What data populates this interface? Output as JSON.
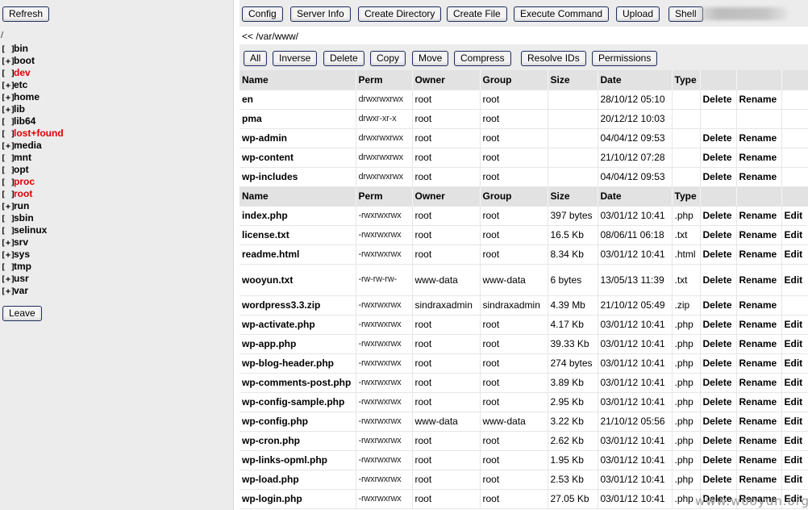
{
  "tree": {
    "refresh_label": "Refresh",
    "root": "/",
    "leave_label": "Leave",
    "items": [
      {
        "mark": "[ ]",
        "name": "bin",
        "red": false
      },
      {
        "mark": "[+]",
        "name": "boot",
        "red": false
      },
      {
        "mark": "[ ]",
        "name": "dev",
        "red": true
      },
      {
        "mark": "[+]",
        "name": "etc",
        "red": false
      },
      {
        "mark": "[+]",
        "name": "home",
        "red": false
      },
      {
        "mark": "[+]",
        "name": "lib",
        "red": false
      },
      {
        "mark": "[ ]",
        "name": "lib64",
        "red": false
      },
      {
        "mark": "[ ]",
        "name": "lost+found",
        "red": true
      },
      {
        "mark": "[+]",
        "name": "media",
        "red": false
      },
      {
        "mark": "[ ]",
        "name": "mnt",
        "red": false
      },
      {
        "mark": "[ ]",
        "name": "opt",
        "red": false
      },
      {
        "mark": "[ ]",
        "name": "proc",
        "red": true
      },
      {
        "mark": "[ ]",
        "name": "root",
        "red": true
      },
      {
        "mark": "[+]",
        "name": "run",
        "red": false
      },
      {
        "mark": "[ ]",
        "name": "sbin",
        "red": false
      },
      {
        "mark": "[ ]",
        "name": "selinux",
        "red": false
      },
      {
        "mark": "[+]",
        "name": "srv",
        "red": false
      },
      {
        "mark": "[+]",
        "name": "sys",
        "red": false
      },
      {
        "mark": "[ ]",
        "name": "tmp",
        "red": false
      },
      {
        "mark": "[+]",
        "name": "usr",
        "red": false
      },
      {
        "mark": "[+]",
        "name": "var",
        "red": false
      }
    ]
  },
  "toolbar": {
    "buttons": [
      "Config",
      "Server Info",
      "Create Directory",
      "Create File",
      "Execute Command",
      "Upload",
      "Shell"
    ]
  },
  "path": "<< /var/www/",
  "actions": {
    "buttons": [
      "All",
      "Inverse",
      "Delete",
      "Copy",
      "Move",
      "Compress",
      "Resolve IDs",
      "Permissions"
    ]
  },
  "columns": [
    "Name",
    "Perm",
    "Owner",
    "Group",
    "Size",
    "Date",
    "Type"
  ],
  "directories": [
    {
      "name": "en",
      "perm": "drwxrwxrwx",
      "owner": "root",
      "group": "root",
      "size": "",
      "date": "28/10/12 05:10",
      "type": "",
      "actions": [
        "Delete",
        "Rename"
      ]
    },
    {
      "name": "pma",
      "perm": "drwxr-xr-x",
      "owner": "root",
      "group": "root",
      "size": "",
      "date": "20/12/12 10:03",
      "type": "",
      "actions": []
    },
    {
      "name": "wp-admin",
      "perm": "drwxrwxrwx",
      "owner": "root",
      "group": "root",
      "size": "",
      "date": "04/04/12 09:53",
      "type": "",
      "actions": [
        "Delete",
        "Rename"
      ]
    },
    {
      "name": "wp-content",
      "perm": "drwxrwxrwx",
      "owner": "root",
      "group": "root",
      "size": "",
      "date": "21/10/12 07:28",
      "type": "",
      "actions": [
        "Delete",
        "Rename"
      ]
    },
    {
      "name": "wp-includes",
      "perm": "drwxrwxrwx",
      "owner": "root",
      "group": "root",
      "size": "",
      "date": "04/04/12 09:53",
      "type": "",
      "actions": [
        "Delete",
        "Rename"
      ]
    }
  ],
  "files": [
    {
      "name": "index.php",
      "perm": "-rwxrwxrwx",
      "owner": "root",
      "group": "root",
      "size": "397 bytes",
      "date": "03/01/12 10:41",
      "type": ".php",
      "actions": [
        "Delete",
        "Rename",
        "Edit"
      ]
    },
    {
      "name": "license.txt",
      "perm": "-rwxrwxrwx",
      "owner": "root",
      "group": "root",
      "size": "16.5 Kb",
      "date": "08/06/11 06:18",
      "type": ".txt",
      "actions": [
        "Delete",
        "Rename",
        "Edit"
      ]
    },
    {
      "name": "readme.html",
      "perm": "-rwxrwxrwx",
      "owner": "root",
      "group": "root",
      "size": "8.34 Kb",
      "date": "03/01/12 10:41",
      "type": ".html",
      "actions": [
        "Delete",
        "Rename",
        "Edit"
      ]
    },
    {
      "name": "wooyun.txt",
      "perm": "-rw-rw-rw-",
      "owner": "www-data",
      "group": "www-data",
      "size": "6 bytes",
      "date": "13/05/13 11:39",
      "type": ".txt",
      "actions": [
        "Delete",
        "Rename",
        "Edit"
      ],
      "tall": true
    },
    {
      "name": "wordpress3.3.zip",
      "perm": "-rwxrwxrwx",
      "owner": "sindraxadmin",
      "group": "sindraxadmin",
      "size": "4.39 Mb",
      "date": "21/10/12 05:49",
      "type": ".zip",
      "actions": [
        "Delete",
        "Rename"
      ]
    },
    {
      "name": "wp-activate.php",
      "perm": "-rwxrwxrwx",
      "owner": "root",
      "group": "root",
      "size": "4.17 Kb",
      "date": "03/01/12 10:41",
      "type": ".php",
      "actions": [
        "Delete",
        "Rename",
        "Edit"
      ]
    },
    {
      "name": "wp-app.php",
      "perm": "-rwxrwxrwx",
      "owner": "root",
      "group": "root",
      "size": "39.33 Kb",
      "date": "03/01/12 10:41",
      "type": ".php",
      "actions": [
        "Delete",
        "Rename",
        "Edit"
      ]
    },
    {
      "name": "wp-blog-header.php",
      "perm": "-rwxrwxrwx",
      "owner": "root",
      "group": "root",
      "size": "274 bytes",
      "date": "03/01/12 10:41",
      "type": ".php",
      "actions": [
        "Delete",
        "Rename",
        "Edit"
      ]
    },
    {
      "name": "wp-comments-post.php",
      "perm": "-rwxrwxrwx",
      "owner": "root",
      "group": "root",
      "size": "3.89 Kb",
      "date": "03/01/12 10:41",
      "type": ".php",
      "actions": [
        "Delete",
        "Rename",
        "Edit"
      ]
    },
    {
      "name": "wp-config-sample.php",
      "perm": "-rwxrwxrwx",
      "owner": "root",
      "group": "root",
      "size": "2.95 Kb",
      "date": "03/01/12 10:41",
      "type": ".php",
      "actions": [
        "Delete",
        "Rename",
        "Edit"
      ]
    },
    {
      "name": "wp-config.php",
      "perm": "-rwxrwxrwx",
      "owner": "www-data",
      "group": "www-data",
      "size": "3.22 Kb",
      "date": "21/10/12 05:56",
      "type": ".php",
      "actions": [
        "Delete",
        "Rename",
        "Edit"
      ]
    },
    {
      "name": "wp-cron.php",
      "perm": "-rwxrwxrwx",
      "owner": "root",
      "group": "root",
      "size": "2.62 Kb",
      "date": "03/01/12 10:41",
      "type": ".php",
      "actions": [
        "Delete",
        "Rename",
        "Edit"
      ]
    },
    {
      "name": "wp-links-opml.php",
      "perm": "-rwxrwxrwx",
      "owner": "root",
      "group": "root",
      "size": "1.95 Kb",
      "date": "03/01/12 10:41",
      "type": ".php",
      "actions": [
        "Delete",
        "Rename",
        "Edit"
      ]
    },
    {
      "name": "wp-load.php",
      "perm": "-rwxrwxrwx",
      "owner": "root",
      "group": "root",
      "size": "2.53 Kb",
      "date": "03/01/12 10:41",
      "type": ".php",
      "actions": [
        "Delete",
        "Rename",
        "Edit"
      ]
    },
    {
      "name": "wp-login.php",
      "perm": "-rwxrwxrwx",
      "owner": "root",
      "group": "root",
      "size": "27.05 Kb",
      "date": "03/01/12 10:41",
      "type": ".php",
      "actions": [
        "Delete",
        "Rename",
        "Edit"
      ]
    }
  ],
  "watermark": "www.wooyun.org"
}
